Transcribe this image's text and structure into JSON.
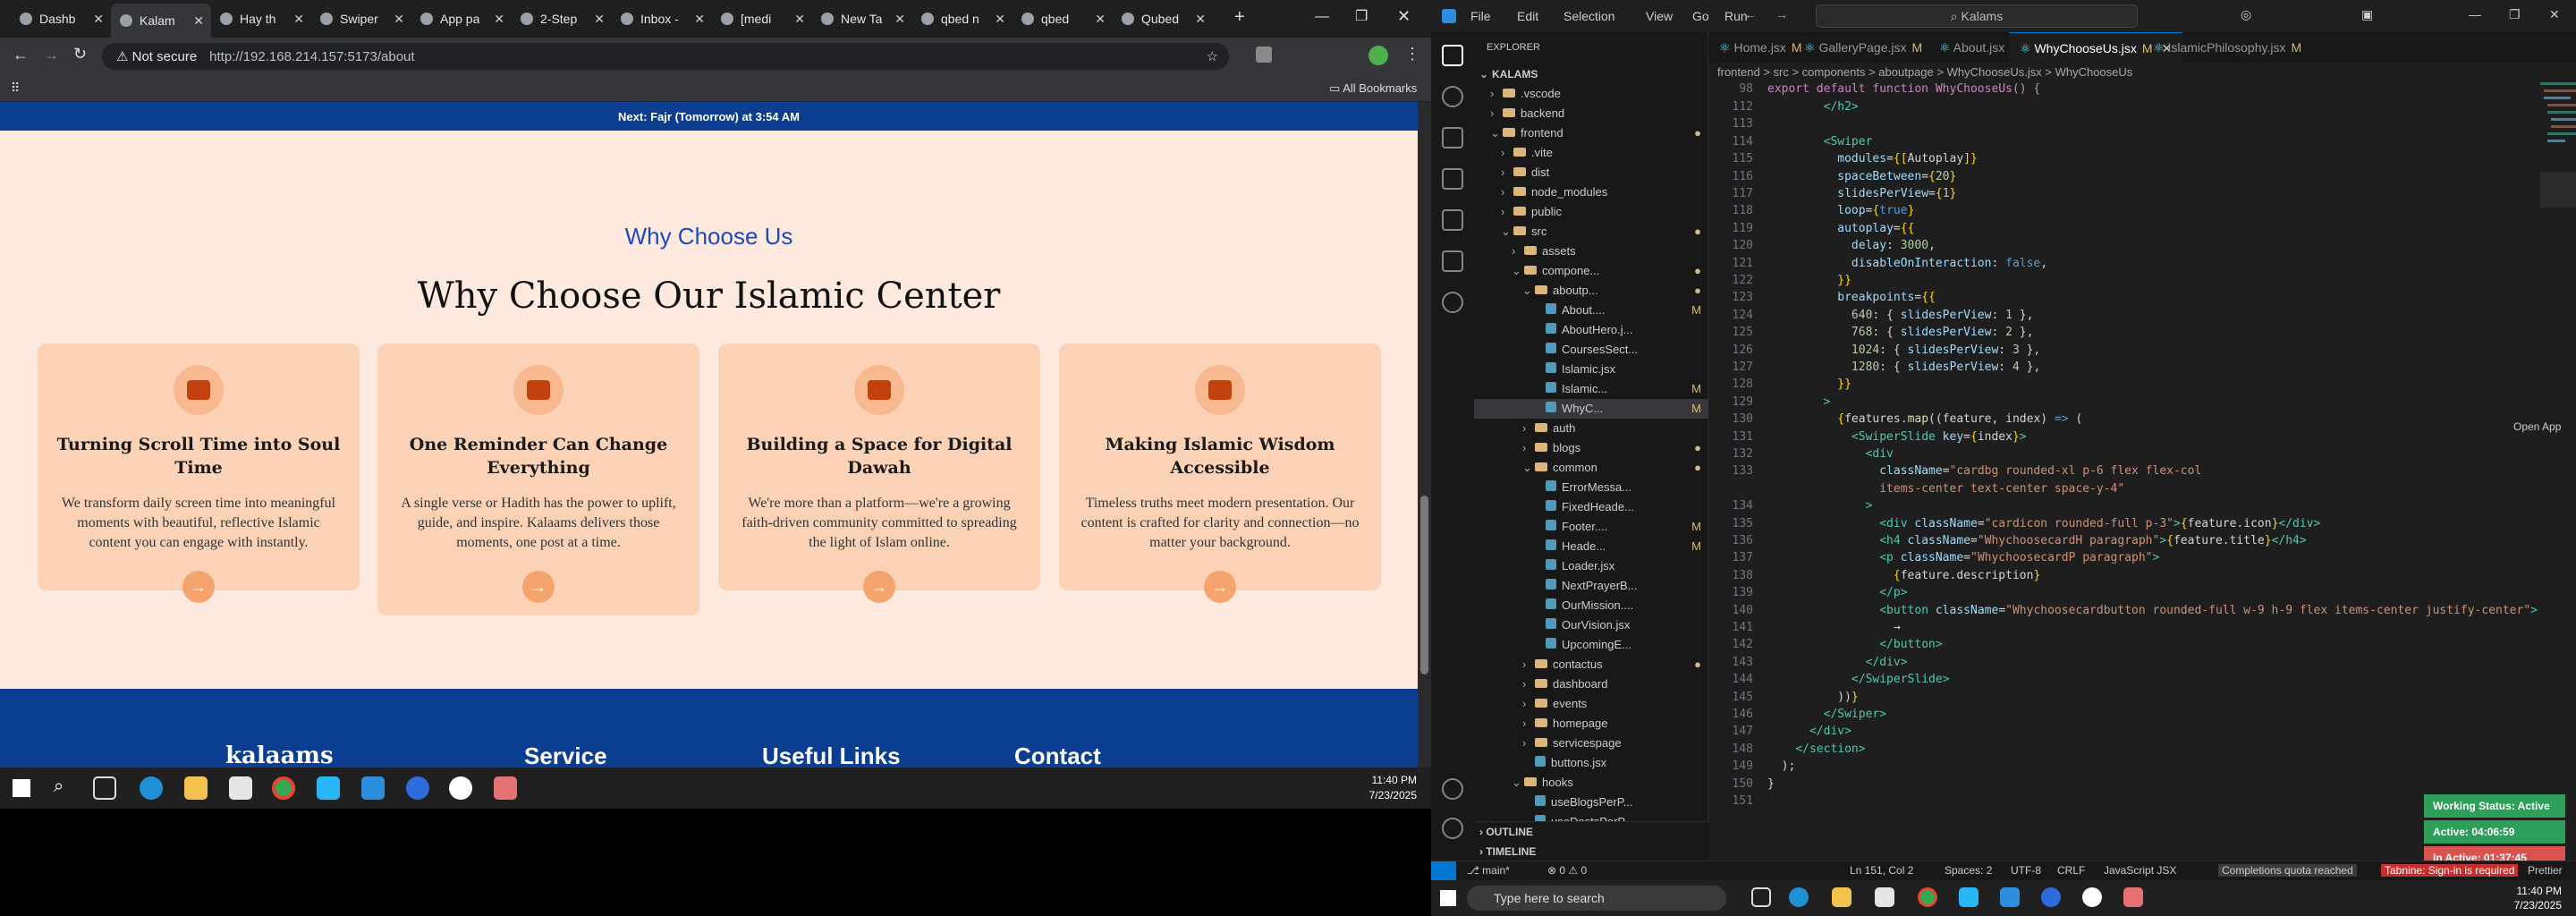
{
  "browser": {
    "tabs": [
      {
        "label": "Dashb"
      },
      {
        "label": "Kalam"
      },
      {
        "label": "Hay th"
      },
      {
        "label": "Swiper"
      },
      {
        "label": "App pa"
      },
      {
        "label": "2-Step"
      },
      {
        "label": "Inbox -"
      },
      {
        "label": "[medi"
      },
      {
        "label": "New Ta"
      },
      {
        "label": "qbed n"
      },
      {
        "label": "qbed"
      },
      {
        "label": "Qubed"
      }
    ],
    "security_label": "Not secure",
    "url": "http://192.168.214.157:5173/about",
    "all_bookmarks": "All Bookmarks"
  },
  "site": {
    "prayer_bar": "Next: Fajr (Tomorrow) at 3:54 AM",
    "section_subtitle": "Why Choose Us",
    "section_title": "Why Choose Our Islamic Center",
    "cards": [
      {
        "icon": "chalkboard-icon",
        "title": "Turning Scroll Time into Soul Time",
        "description": "We transform daily screen time into meaningful moments with beautiful, reflective Islamic content you can engage with instantly.",
        "button": "→"
      },
      {
        "icon": "users-icon",
        "title": "One Reminder Can Change Everything",
        "description": "A single verse or Hadith has the power to uplift, guide, and inspire. Kalaams delivers those moments, one post at a time.",
        "button": "→"
      },
      {
        "icon": "calendar-icon",
        "title": "Building a Space for Digital Dawah",
        "description": "We're more than a platform—we're a growing faith-driven community committed to spreading the light of Islam online.",
        "button": "→"
      },
      {
        "icon": "people-icon",
        "title": "Making Islamic Wisdom Accessible",
        "description": "Timeless truths meet modern presentation. Our content is crafted for clarity and connection—no matter your background.",
        "button": "→"
      }
    ],
    "footer": {
      "logo": "kalaams",
      "columns": [
        "Service",
        "Useful Links",
        "Contact"
      ]
    }
  },
  "taskbar_left": {
    "time": "11:40 PM",
    "date": "7/23/2025"
  },
  "vscode": {
    "menu": [
      "File",
      "Edit",
      "Selection",
      "View",
      "Go",
      "Run"
    ],
    "search": "Kalams",
    "explorer_title": "EXPLORER",
    "workspace": "KALAMS",
    "tree": [
      {
        "label": ".vscode",
        "type": "folder",
        "depth": 1,
        "open": false
      },
      {
        "label": "backend",
        "type": "folder",
        "depth": 1,
        "open": false
      },
      {
        "label": "frontend",
        "type": "folder",
        "depth": 1,
        "open": true,
        "mark": "●"
      },
      {
        "label": ".vite",
        "type": "folder",
        "depth": 2,
        "open": false
      },
      {
        "label": "dist",
        "type": "folder",
        "depth": 2,
        "open": false
      },
      {
        "label": "node_modules",
        "type": "folder",
        "depth": 2,
        "open": false
      },
      {
        "label": "public",
        "type": "folder",
        "depth": 2,
        "open": false
      },
      {
        "label": "src",
        "type": "folder",
        "depth": 2,
        "open": true,
        "mark": "●"
      },
      {
        "label": "assets",
        "type": "folder",
        "depth": 3,
        "open": false
      },
      {
        "label": "compone...",
        "type": "folder",
        "depth": 3,
        "open": true,
        "mark": "●"
      },
      {
        "label": "aboutp...",
        "type": "folder",
        "depth": 4,
        "open": true,
        "mark": "●"
      },
      {
        "label": "About....",
        "type": "file",
        "depth": 5,
        "mark": "M"
      },
      {
        "label": "AboutHero.j...",
        "type": "file",
        "depth": 5
      },
      {
        "label": "CoursesSect...",
        "type": "file",
        "depth": 5
      },
      {
        "label": "Islamic.jsx",
        "type": "file",
        "depth": 5
      },
      {
        "label": "Islamic...",
        "type": "file",
        "depth": 5,
        "mark": "M"
      },
      {
        "label": "WhyC...",
        "type": "file",
        "depth": 5,
        "mark": "M",
        "selected": true
      },
      {
        "label": "auth",
        "type": "folder",
        "depth": 4,
        "open": false
      },
      {
        "label": "blogs",
        "type": "folder",
        "depth": 4,
        "open": false,
        "mark": "●"
      },
      {
        "label": "common",
        "type": "folder",
        "depth": 4,
        "open": true,
        "mark": "●"
      },
      {
        "label": "ErrorMessa...",
        "type": "file",
        "depth": 5
      },
      {
        "label": "FixedHeade...",
        "type": "file",
        "depth": 5
      },
      {
        "label": "Footer....",
        "type": "file",
        "depth": 5,
        "mark": "M"
      },
      {
        "label": "Heade...",
        "type": "file",
        "depth": 5,
        "mark": "M"
      },
      {
        "label": "Loader.jsx",
        "type": "file",
        "depth": 5
      },
      {
        "label": "NextPrayerB...",
        "type": "file",
        "depth": 5
      },
      {
        "label": "OurMission....",
        "type": "file",
        "depth": 5
      },
      {
        "label": "OurVision.jsx",
        "type": "file",
        "depth": 5
      },
      {
        "label": "UpcomingE...",
        "type": "file",
        "depth": 5
      },
      {
        "label": "contactus",
        "type": "folder",
        "depth": 4,
        "open": false,
        "mark": "●"
      },
      {
        "label": "dashboard",
        "type": "folder",
        "depth": 4,
        "open": false
      },
      {
        "label": "events",
        "type": "folder",
        "depth": 4,
        "open": false
      },
      {
        "label": "homepage",
        "type": "folder",
        "depth": 4,
        "open": false
      },
      {
        "label": "servicespage",
        "type": "folder",
        "depth": 4,
        "open": false
      },
      {
        "label": "buttons.jsx",
        "type": "file",
        "depth": 4
      },
      {
        "label": "hooks",
        "type": "folder",
        "depth": 3,
        "open": true
      },
      {
        "label": "useBlogsPerP...",
        "type": "file",
        "depth": 4
      },
      {
        "label": "useDostsPerP...",
        "type": "file",
        "depth": 4
      }
    ],
    "outline": "OUTLINE",
    "timeline": "TIMELINE",
    "tabs": [
      {
        "label": "Home.jsx",
        "mark": "M"
      },
      {
        "label": "GalleryPage.jsx",
        "mark": "M"
      },
      {
        "label": "About.jsx",
        "mark": ""
      },
      {
        "label": "WhyChooseUs.jsx",
        "mark": "M"
      },
      {
        "label": "IslamicPhilosophy.jsx",
        "mark": "M"
      }
    ],
    "breadcrumb": "frontend > src > components > aboutpage > WhyChooseUs.jsx > WhyChooseUs",
    "sticky_line": "98",
    "sticky_code": "export default function WhyChooseUs() {",
    "lines": [
      {
        "n": "112",
        "html": "        <span class='t'>&lt;/h2&gt;</span>"
      },
      {
        "n": "113",
        "html": ""
      },
      {
        "n": "114",
        "html": "        <span class='t'>&lt;Swiper</span>"
      },
      {
        "n": "115",
        "html": "          <span class='a'>modules</span>=<span class='p'>{[</span>Autoplay<span class='p'>]}</span>"
      },
      {
        "n": "116",
        "html": "          <span class='a'>spaceBetween</span>=<span class='p'>{</span><span class='n'>20</span><span class='p'>}</span>"
      },
      {
        "n": "117",
        "html": "          <span class='a'>slidesPerView</span>=<span class='p'>{</span><span class='n'>1</span><span class='p'>}</span>"
      },
      {
        "n": "118",
        "html": "          <span class='a'>loop</span>=<span class='p'>{</span><span class='k'>true</span><span class='p'>}</span>"
      },
      {
        "n": "119",
        "html": "          <span class='a'>autoplay</span>=<span class='p'>{{</span>"
      },
      {
        "n": "120",
        "html": "            <span class='a'>delay</span>: <span class='n'>3000</span>,"
      },
      {
        "n": "121",
        "html": "            <span class='a'>disableOnInteraction</span>: <span class='k'>false</span>,"
      },
      {
        "n": "122",
        "html": "          <span class='p'>}}</span>"
      },
      {
        "n": "123",
        "html": "          <span class='a'>breakpoints</span>=<span class='p'>{{</span>"
      },
      {
        "n": "124",
        "html": "            <span class='n'>640</span>: { <span class='a'>slidesPerView</span>: <span class='n'>1</span> },"
      },
      {
        "n": "125",
        "html": "            <span class='n'>768</span>: { <span class='a'>slidesPerView</span>: <span class='n'>2</span> },"
      },
      {
        "n": "126",
        "html": "            <span class='n'>1024</span>: { <span class='a'>slidesPerView</span>: <span class='n'>3</span> },"
      },
      {
        "n": "127",
        "html": "            <span class='n'>1280</span>: { <span class='a'>slidesPerView</span>: <span class='n'>4</span> },"
      },
      {
        "n": "128",
        "html": "          <span class='p'>}}</span>"
      },
      {
        "n": "129",
        "html": "        <span class='t'>&gt;</span>"
      },
      {
        "n": "130",
        "html": "          <span class='p'>{</span>features.<span class='f'>map</span>((feature, index) <span class='k'>=&gt;</span> ("
      },
      {
        "n": "131",
        "html": "            <span class='t'>&lt;SwiperSlide</span> <span class='a'>key</span>=<span class='p'>{</span>index<span class='p'>}</span><span class='t'>&gt;</span>"
      },
      {
        "n": "132",
        "html": "              <span class='t'>&lt;div</span>"
      },
      {
        "n": "133",
        "html": "                <span class='a'>className</span>=<span class='s'>\"cardbg rounded-xl p-6 flex flex-col</span>"
      },
      {
        "n": "",
        "html": "                <span class='s'>items-center text-center space-y-4\"</span>"
      },
      {
        "n": "134",
        "html": "              <span class='t'>&gt;</span>"
      },
      {
        "n": "135",
        "html": "                <span class='t'>&lt;div</span> <span class='a'>className</span>=<span class='s'>\"cardicon rounded-full p-3\"</span><span class='t'>&gt;</span><span class='p'>{</span>feature.icon<span class='p'>}</span><span class='t'>&lt;/div&gt;</span>"
      },
      {
        "n": "136",
        "html": "                <span class='t'>&lt;h4</span> <span class='a'>className</span>=<span class='s'>\"WhychoosecardH paragraph\"</span><span class='t'>&gt;</span><span class='p'>{</span>feature.title<span class='p'>}</span><span class='t'>&lt;/h4&gt;</span>"
      },
      {
        "n": "137",
        "html": "                <span class='t'>&lt;p</span> <span class='a'>className</span>=<span class='s'>\"WhychoosecardP paragraph\"</span><span class='t'>&gt;</span>"
      },
      {
        "n": "138",
        "html": "                  <span class='p'>{</span>feature.description<span class='p'>}</span>"
      },
      {
        "n": "139",
        "html": "                <span class='t'>&lt;/p&gt;</span>"
      },
      {
        "n": "140",
        "html": "                <span class='t'>&lt;button</span> <span class='a'>className</span>=<span class='s'>\"Whychoosecardbutton rounded-full w-9 h-9 flex items-center justify-center\"</span><span class='t'>&gt;</span>"
      },
      {
        "n": "141",
        "html": "                  →"
      },
      {
        "n": "142",
        "html": "                <span class='t'>&lt;/button&gt;</span>"
      },
      {
        "n": "143",
        "html": "              <span class='t'>&lt;/div&gt;</span>"
      },
      {
        "n": "144",
        "html": "            <span class='t'>&lt;/SwiperSlide&gt;</span>"
      },
      {
        "n": "145",
        "html": "          ))<span class='p'>}</span>"
      },
      {
        "n": "146",
        "html": "        <span class='t'>&lt;/Swiper&gt;</span>"
      },
      {
        "n": "147",
        "html": "      <span class='t'>&lt;/div&gt;</span>"
      },
      {
        "n": "148",
        "html": "    <span class='t'>&lt;/section&gt;</span>"
      },
      {
        "n": "149",
        "html": "  );"
      },
      {
        "n": "150",
        "html": "}"
      },
      {
        "n": "151",
        "html": ""
      }
    ],
    "open_app": "Open App",
    "working_status": [
      {
        "label": "Working Status: Active",
        "color": "#2e9e5b"
      },
      {
        "label": "Active: 04:06:59",
        "color": "#2e9e5b"
      },
      {
        "label": "In Active: 01:37:45",
        "color": "#d9534f"
      }
    ],
    "status": {
      "branch": "main*",
      "problems": "⊗ 0 ⚠ 0",
      "position": "Ln 151, Col 2",
      "spaces": "Spaces: 2",
      "encoding": "UTF-8",
      "eol": "CRLF",
      "language": "JavaScript JSX",
      "completions": "Completions quota reached",
      "tabnine": "Tabnine: Sign-in is required",
      "prettier": "Prettier"
    }
  },
  "taskbar_right": {
    "search_placeholder": "Type here to search",
    "time": "11:40 PM",
    "date": "7/23/2025"
  }
}
